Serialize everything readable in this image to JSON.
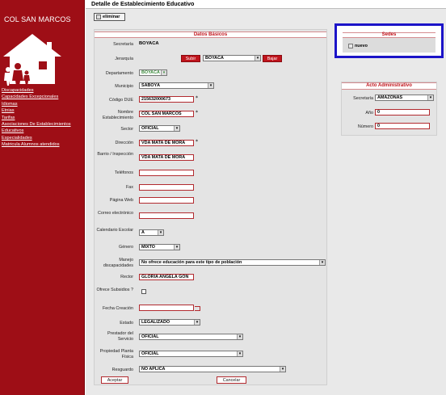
{
  "sidebar": {
    "school_name": "COL SAN MARCOS",
    "links": [
      "Discapacidades",
      "Capacidades Excepcionales",
      "Idiomas",
      "Etnias",
      "Tarifas",
      "Asociaciones De Establecimientos Educativos",
      "Especialidades",
      "Matricula Alumnos atendidos"
    ]
  },
  "header": {
    "title": "Detalle de Establecimiento Educativo"
  },
  "toolbar": {
    "delete_label": "eliminar"
  },
  "form": {
    "section_title": "Datos Básicos",
    "secretaria": {
      "label": "Secretaría",
      "value": "BOYACA"
    },
    "jerarquia": {
      "label": "Jerarquía",
      "subir": "Subir",
      "value": "BOYACA",
      "bajar": "Bajar"
    },
    "departamento": {
      "label": "Departamento",
      "value": "BOYACA"
    },
    "municipio": {
      "label": "Municipio",
      "value": "SABOYÁ"
    },
    "codigo_due": {
      "label": "Código DUE",
      "value": "215632000673"
    },
    "nombre": {
      "label": "Nombre Establecimiento",
      "value": "COL SAN MARCOS"
    },
    "sector": {
      "label": "Sector",
      "value": "OFICIAL"
    },
    "direccion": {
      "label": "Dirección",
      "value": "VDA MATA DE MORA"
    },
    "barrio": {
      "label": "Barrio / Inspección",
      "value": "VDA MATA DE MORA"
    },
    "telefonos": {
      "label": "Teléfonos",
      "value": ""
    },
    "fax": {
      "label": "Fax",
      "value": ""
    },
    "pagina_web": {
      "label": "Página Web",
      "value": ""
    },
    "correo": {
      "label": "Correo electrónico",
      "value": ""
    },
    "calendario": {
      "label": "Calendario Escolar",
      "value": "A"
    },
    "genero": {
      "label": "Género",
      "value": "MIXTO"
    },
    "manejo": {
      "label": "Manejo discapacidades",
      "value": "No ofrece educación para este tipo de población"
    },
    "rector": {
      "label": "Rector",
      "value": "GLORIA ANGELA GON"
    },
    "ofrece_subsidios": {
      "label": "Ofrece Subsidios ?",
      "checked": false
    },
    "fecha_creacion": {
      "label": "Fecha Creación",
      "value": ""
    },
    "estado": {
      "label": "Estado",
      "value": "LEGALIZADO"
    },
    "prestador": {
      "label": "Prestador del Servicio",
      "value": "OFICIAL"
    },
    "propiedad": {
      "label": "Propiedad Planta Física",
      "value": "OFICIAL"
    },
    "resguardo": {
      "label": "Resguardo",
      "value": "NO APLICA"
    },
    "required_mark": "*",
    "aceptar": "Aceptar",
    "cancelar": "Cancelar"
  },
  "sedes": {
    "title": "Sedes",
    "nuevo": "nuevo",
    "highlight_color": "#1c14c8"
  },
  "acto": {
    "title": "Acto Administrativo",
    "secretaria": {
      "label": "Secretaría",
      "value": "AMAZONAS"
    },
    "anio": {
      "label": "Año",
      "value": "0"
    },
    "numero": {
      "label": "Número",
      "value": "0"
    }
  },
  "colors": {
    "brand_red": "#9e0e16",
    "accent_red": "#c0141c",
    "panel_gray": "#e4e4e4"
  },
  "icons": {
    "logo": "house-family-icon",
    "dropdown": "chevron-down-icon"
  }
}
